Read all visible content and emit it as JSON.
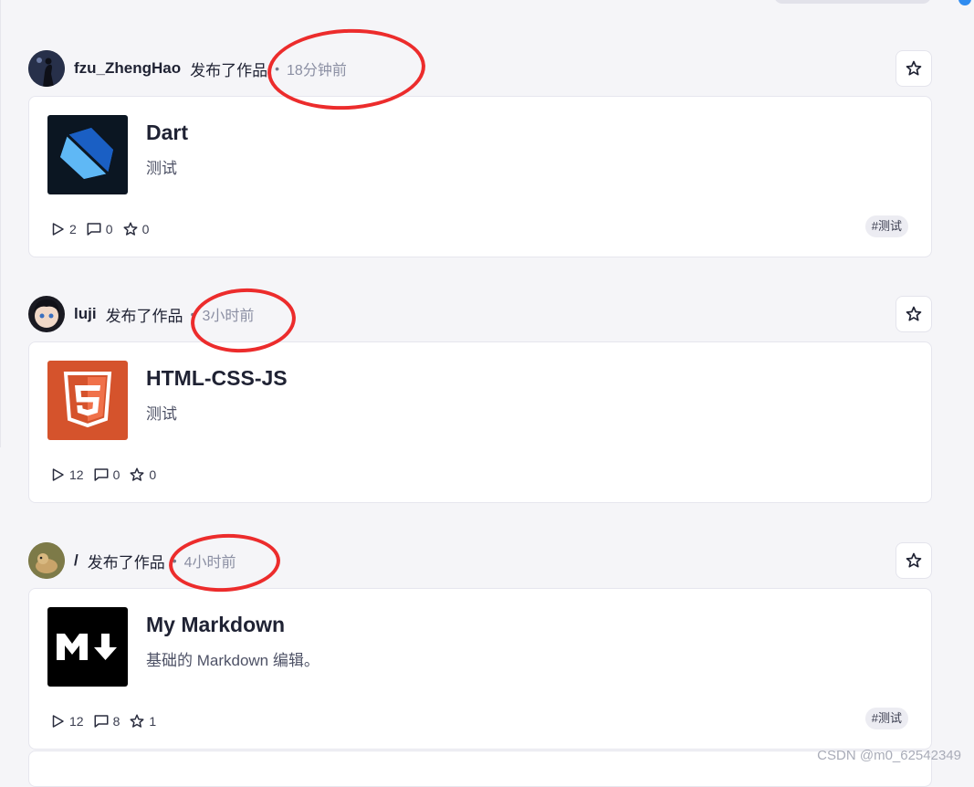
{
  "feed": {
    "items": [
      {
        "author": "fzu_ZhengHao",
        "action": "发布了作品",
        "separator": "•",
        "time": "18分钟前",
        "avatar_icon": "avatar-dark-silhouette",
        "project": {
          "title": "Dart",
          "description": "测试",
          "logo_icon": "dart-logo",
          "plays": "2",
          "comments": "0",
          "stars": "0",
          "tag": "#测试"
        }
      },
      {
        "author": "luji",
        "action": "发布了作品",
        "separator": "•",
        "time": "3小时前",
        "avatar_icon": "avatar-anime-face",
        "project": {
          "title": "HTML-CSS-JS",
          "description": "测试",
          "logo_icon": "html5-logo",
          "plays": "12",
          "comments": "0",
          "stars": "0",
          "tag": ""
        }
      },
      {
        "author": "/",
        "action": "发布了作品",
        "separator": "•",
        "time": "4小时前",
        "avatar_icon": "avatar-photo",
        "project": {
          "title": "My Markdown",
          "description": "基础的 Markdown 编辑。",
          "logo_icon": "markdown-logo",
          "plays": "12",
          "comments": "8",
          "stars": "1",
          "tag": "#测试"
        }
      }
    ]
  },
  "watermark": "CSDN @m0_62542349",
  "colors": {
    "annotation": "#ec2c2c",
    "page_bg": "#f5f5f8",
    "dart_blue": "#1f6fd8",
    "html5_orange": "#d5532c"
  }
}
